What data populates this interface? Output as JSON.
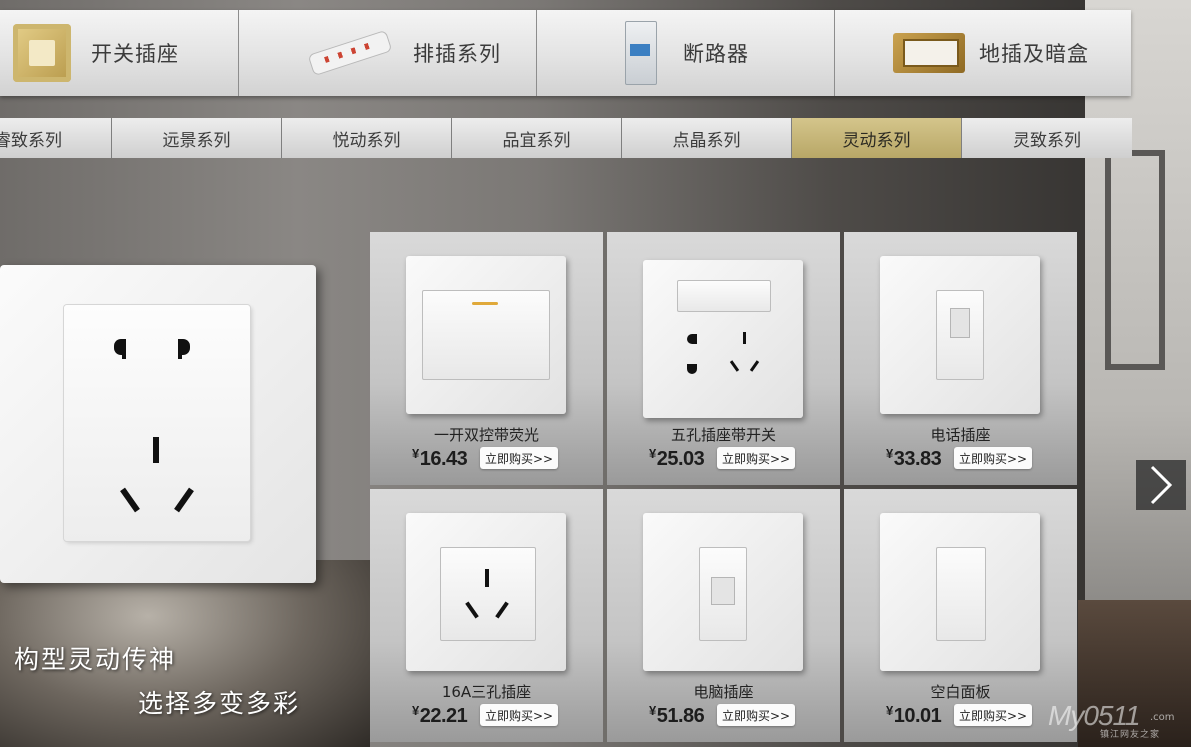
{
  "categories": [
    {
      "label": "开关插座",
      "icon": "wall-outlet-icon"
    },
    {
      "label": "排插系列",
      "icon": "power-strip-icon"
    },
    {
      "label": "断路器",
      "icon": "circuit-breaker-icon"
    },
    {
      "label": "地插及暗盒",
      "icon": "floor-socket-icon"
    }
  ],
  "series_tabs": [
    {
      "label": "睿致系列",
      "active": false
    },
    {
      "label": "远景系列",
      "active": false
    },
    {
      "label": "悦动系列",
      "active": false
    },
    {
      "label": "品宜系列",
      "active": false
    },
    {
      "label": "点晶系列",
      "active": false
    },
    {
      "label": "灵动系列",
      "active": true
    },
    {
      "label": "灵致系列",
      "active": false
    }
  ],
  "hero": {
    "slogan_line1": "构型灵动传神",
    "slogan_line2": "选择多变多彩"
  },
  "products": [
    {
      "name": "一开双控带荧光",
      "currency": "¥",
      "price": "16.43",
      "buy_label": "立即购买>>",
      "image": "switch-panel-icon"
    },
    {
      "name": "五孔插座带开关",
      "currency": "¥",
      "price": "25.03",
      "buy_label": "立即购买>>",
      "image": "switched-outlet-icon"
    },
    {
      "name": "电话插座",
      "currency": "¥",
      "price": "33.83",
      "buy_label": "立即购买>>",
      "image": "phone-jack-icon"
    },
    {
      "name": "16A三孔插座",
      "currency": "¥",
      "price": "22.21",
      "buy_label": "立即购买>>",
      "image": "three-pin-outlet-icon"
    },
    {
      "name": "电脑插座",
      "currency": "¥",
      "price": "51.86",
      "buy_label": "立即购买>>",
      "image": "network-jack-icon"
    },
    {
      "name": "空白面板",
      "currency": "¥",
      "price": "10.01",
      "buy_label": "立即购买>>",
      "image": "blank-panel-icon"
    }
  ],
  "watermark": {
    "brand": "My0511",
    "dotcom": ".com",
    "tagline": "镇江网友之家"
  },
  "colors": {
    "active_tab": "#c4b474",
    "topbar": "#e3e3e3"
  }
}
